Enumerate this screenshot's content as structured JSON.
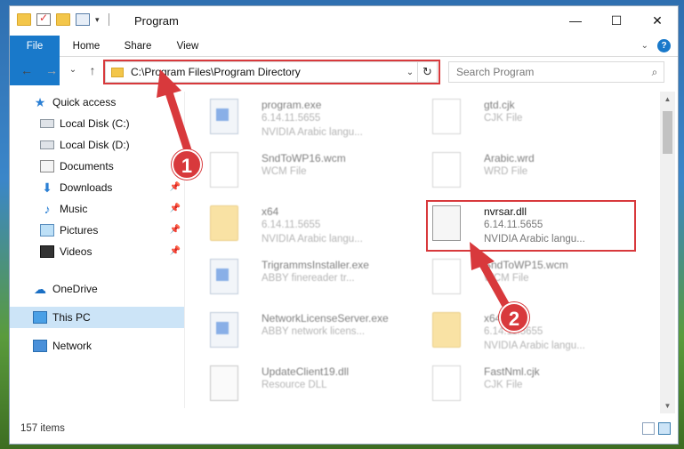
{
  "window": {
    "title": "Program"
  },
  "window_controls": {
    "minimize": "—",
    "maximize": "☐",
    "close": "✕"
  },
  "ribbon": {
    "tabs": [
      {
        "label": "File"
      },
      {
        "label": "Home"
      },
      {
        "label": "Share"
      },
      {
        "label": "View"
      }
    ],
    "expand": "⌄",
    "help": "?"
  },
  "nav": {
    "back": "←",
    "forward": "→",
    "recent": "⌄",
    "up": "↑",
    "address": "C:\\Program Files\\Program Directory",
    "address_dropdown": "⌄",
    "refresh": "↻"
  },
  "search": {
    "placeholder": "Search Program",
    "icon": "⌕"
  },
  "sidebar": {
    "items": [
      {
        "label": "Quick access",
        "icon": "star-icon",
        "pinned": false
      },
      {
        "label": "Local Disk (C:)",
        "icon": "disk-icon",
        "pinned": false
      },
      {
        "label": "Local Disk (D:)",
        "icon": "disk-icon",
        "pinned": false
      },
      {
        "label": "Documents",
        "icon": "documents-icon",
        "pinned": false
      },
      {
        "label": "Downloads",
        "icon": "download-icon",
        "pinned": true
      },
      {
        "label": "Music",
        "icon": "music-icon",
        "pinned": true
      },
      {
        "label": "Pictures",
        "icon": "pictures-icon",
        "pinned": true
      },
      {
        "label": "Videos",
        "icon": "videos-icon",
        "pinned": true
      },
      {
        "label": "OneDrive",
        "icon": "onedrive-icon",
        "pinned": false
      },
      {
        "label": "This PC",
        "icon": "pc-icon",
        "pinned": false,
        "active": true
      },
      {
        "label": "Network",
        "icon": "network-icon",
        "pinned": false
      }
    ]
  },
  "files": [
    {
      "name": "program.exe",
      "line2": "6.14.11.5655",
      "line3": "NVIDIA Arabic langu...",
      "icon": "exe-icon"
    },
    {
      "name": "gtd.cjk",
      "line2": "CJK File",
      "line3": "",
      "icon": "page-icon"
    },
    {
      "name": "SndToWP16.wcm",
      "line2": "WCM File",
      "line3": "",
      "icon": "page-icon"
    },
    {
      "name": "Arabic.wrd",
      "line2": "WRD File",
      "line3": "",
      "icon": "page-icon"
    },
    {
      "name": "x64",
      "line2": "6.14.11.5655",
      "line3": "NVIDIA Arabic langu...",
      "icon": "folder-icon"
    },
    {
      "name": "nvrsar.dll",
      "line2": "6.14.11.5655",
      "line3": "NVIDIA Arabic langu...",
      "icon": "gear-file-icon"
    },
    {
      "name": "TrigrammsInstaller.exe",
      "line2": "ABBY finereader tr...",
      "line3": "",
      "icon": "exe-icon"
    },
    {
      "name": "SndToWP15.wcm",
      "line2": "WCM File",
      "line3": "",
      "icon": "page-icon"
    },
    {
      "name": "NetworkLicenseServer.exe",
      "line2": "ABBY network licens...",
      "line3": "",
      "icon": "exe-icon"
    },
    {
      "name": "x64",
      "line2": "6.14.11.5655",
      "line3": "NVIDIA Arabic langu...",
      "icon": "folder-icon"
    },
    {
      "name": "UpdateClient19.dll",
      "line2": "Resource DLL",
      "line3": "",
      "icon": "gear-file-icon"
    },
    {
      "name": "FastNml.cjk",
      "line2": "CJK File",
      "line3": "",
      "icon": "page-icon"
    }
  ],
  "status": {
    "items": "157 items"
  },
  "annotations": {
    "callout1": "1",
    "callout2": "2",
    "color": "#d8393c"
  },
  "colors": {
    "accent": "#1979ca",
    "selection": "#cce4f7",
    "highlight": "#d8393c"
  }
}
